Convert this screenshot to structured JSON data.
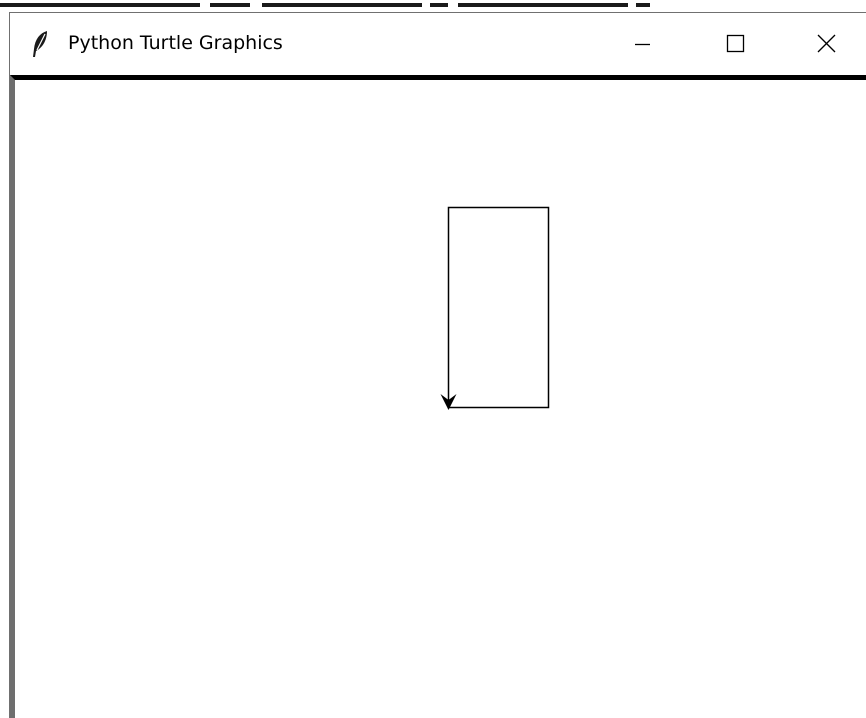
{
  "window": {
    "title": "Python Turtle Graphics",
    "app_icon": "feather-icon",
    "controls": [
      "minimize-icon",
      "maximize-icon",
      "close-icon"
    ]
  },
  "canvas": {
    "background": "#ffffff",
    "pen_color": "#000000",
    "drawing": "rectangle outline",
    "turtle_shape": "classic arrow",
    "turtle_heading": "down"
  }
}
